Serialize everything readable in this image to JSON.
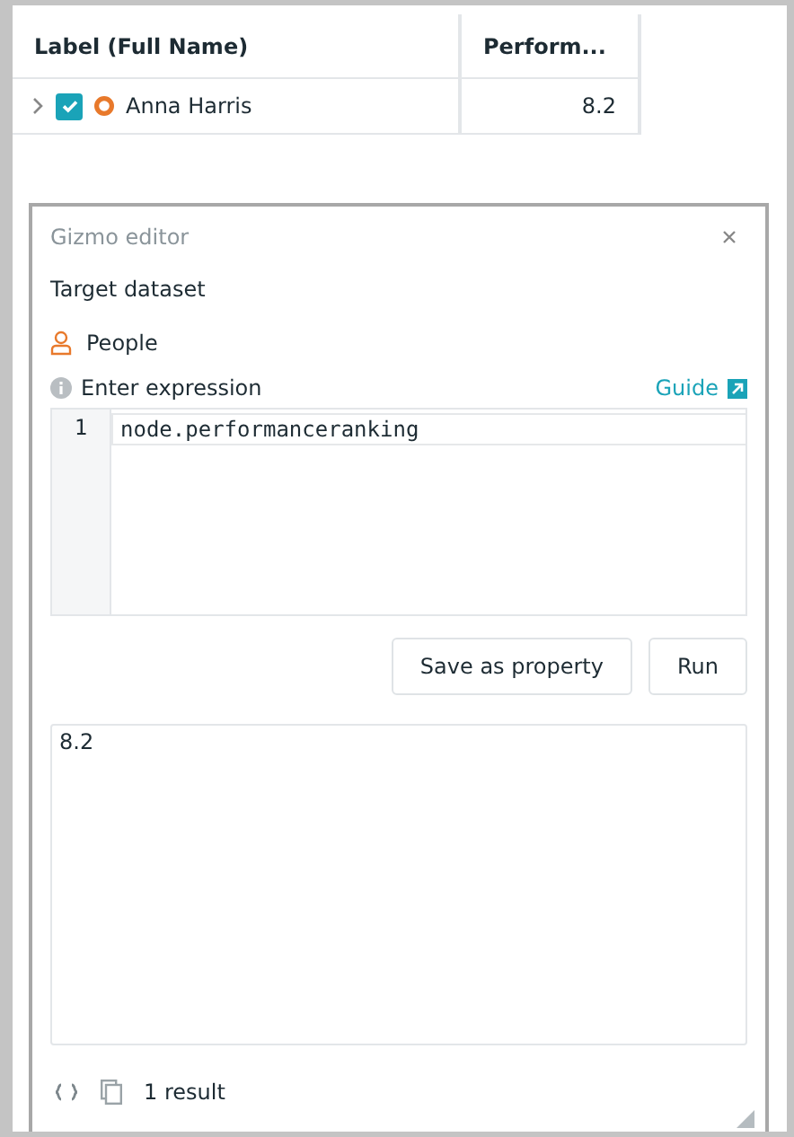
{
  "table": {
    "columns": [
      "Label (Full Name)",
      "Perform..."
    ],
    "rows": [
      {
        "expanded": false,
        "checked": true,
        "label": "Anna Harris",
        "value": "8.2"
      }
    ]
  },
  "editor": {
    "title": "Gizmo editor",
    "target_label": "Target dataset",
    "dataset": "People",
    "expression_label": "Enter expression",
    "guide_link": "Guide",
    "lines": [
      {
        "number": "1",
        "code": "node.performanceranking"
      }
    ],
    "buttons": [
      "Save as property",
      "Run"
    ],
    "output": "8.2",
    "result_count": "1 result"
  }
}
